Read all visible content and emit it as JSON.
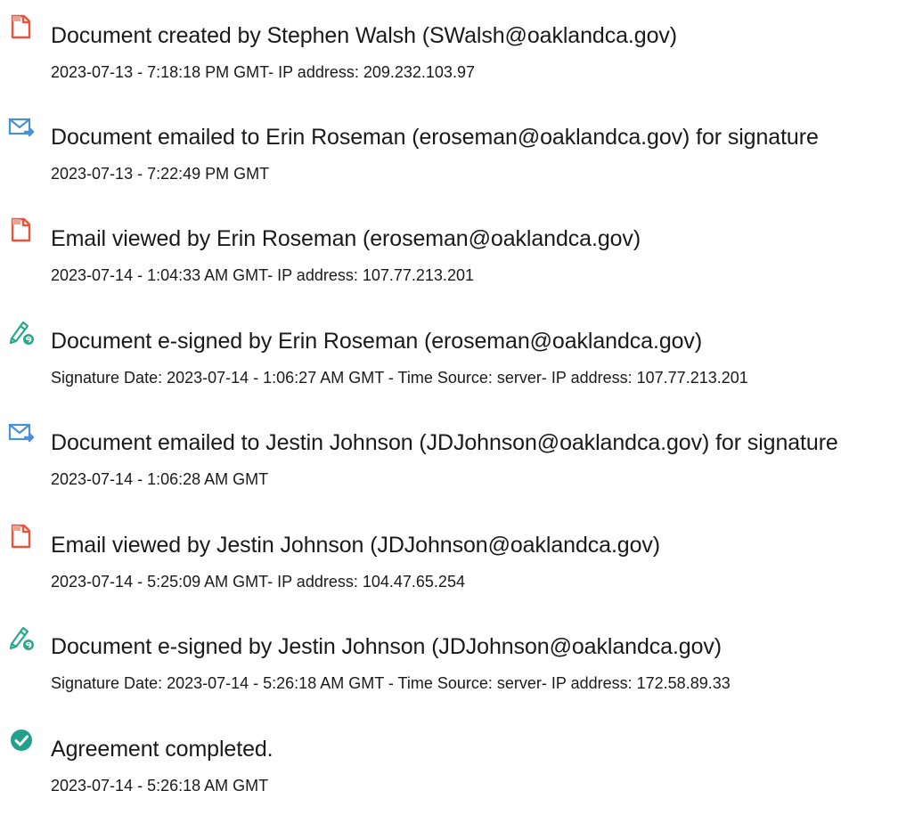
{
  "colors": {
    "document_icon": "#e8553d",
    "email_icon": "#4a90d9",
    "sign_icon": "#2aa88a",
    "complete_icon": "#23a08c",
    "text": "#1a1a1a"
  },
  "entries": [
    {
      "icon": "document-icon",
      "title": "Document created by Stephen Walsh (SWalsh@oaklandca.gov)",
      "detail": "2023-07-13 - 7:18:18 PM GMT- IP address: 209.232.103.97"
    },
    {
      "icon": "email-sent-icon",
      "title": "Document emailed to Erin Roseman (eroseman@oaklandca.gov) for signature",
      "detail": "2023-07-13 - 7:22:49 PM GMT"
    },
    {
      "icon": "document-icon",
      "title": "Email viewed by Erin Roseman (eroseman@oaklandca.gov)",
      "detail": "2023-07-14 - 1:04:33 AM GMT- IP address: 107.77.213.201"
    },
    {
      "icon": "e-sign-pen-icon",
      "title": "Document e-signed by Erin Roseman (eroseman@oaklandca.gov)",
      "detail": "Signature Date: 2023-07-14 - 1:06:27 AM GMT - Time Source: server- IP address: 107.77.213.201"
    },
    {
      "icon": "email-sent-icon",
      "title": "Document emailed to Jestin Johnson (JDJohnson@oaklandca.gov) for signature",
      "detail": "2023-07-14 - 1:06:28 AM GMT"
    },
    {
      "icon": "document-icon",
      "title": "Email viewed by Jestin Johnson (JDJohnson@oaklandca.gov)",
      "detail": "2023-07-14 - 5:25:09 AM GMT- IP address: 104.47.65.254"
    },
    {
      "icon": "e-sign-pen-icon",
      "title": "Document e-signed by Jestin Johnson (JDJohnson@oaklandca.gov)",
      "detail": "Signature Date: 2023-07-14 - 5:26:18 AM GMT - Time Source: server- IP address: 172.58.89.33"
    },
    {
      "icon": "checkmark-circle-icon",
      "title": "Agreement completed.",
      "detail": "2023-07-14 - 5:26:18 AM GMT"
    }
  ]
}
